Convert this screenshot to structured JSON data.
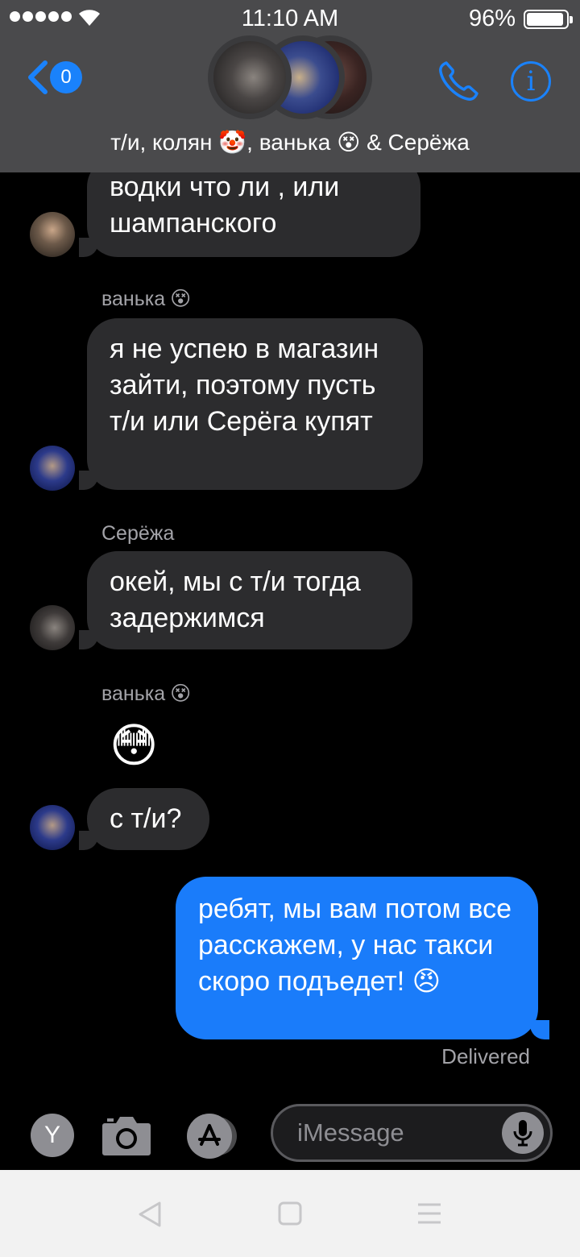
{
  "status_bar": {
    "time": "11:10 AM",
    "battery": "96%"
  },
  "header": {
    "back_badge": "0",
    "title": "т/и, колян 🤡, ванька 😵 & Серёжа",
    "info_glyph": "i"
  },
  "messages": [
    {
      "text_lines": [
        "водки что ли , или",
        "шампанского"
      ]
    },
    {
      "sender": "ванька",
      "sender_emoji": "😵"
    },
    {
      "text": "я не успею в магазин зайти, поэтому пусть т/и или Серёга купят"
    },
    {
      "sender": "Серёжа"
    },
    {
      "text": "окей, мы с т/и тогда задержимся"
    },
    {
      "sender": "ванька",
      "sender_emoji": "😵"
    },
    {
      "emoji": "😳"
    },
    {
      "text": "с т/и?"
    },
    {
      "text": "ребят, мы вам потом все расскажем, у нас такси скоро подъедет! 😠",
      "outgoing": true
    }
  ],
  "delivered": "Delivered",
  "input": {
    "app_letter": "Y",
    "placeholder": "iMessage"
  },
  "icons": {
    "back": "chevron-left-icon",
    "call": "phone-icon",
    "info": "info-icon",
    "camera": "camera-icon",
    "appstore": "app-store-icon",
    "mic": "microphone-icon",
    "nav_back": "triangle-back-icon",
    "nav_home": "square-home-icon",
    "nav_menu": "menu-lines-icon"
  },
  "colors": {
    "header": "#4a4a4c",
    "accent": "#1a82fb",
    "incoming_bubble": "#2c2c2e",
    "outgoing_bubble": "#1a7cfa",
    "meta_text": "#a3a3a8"
  }
}
